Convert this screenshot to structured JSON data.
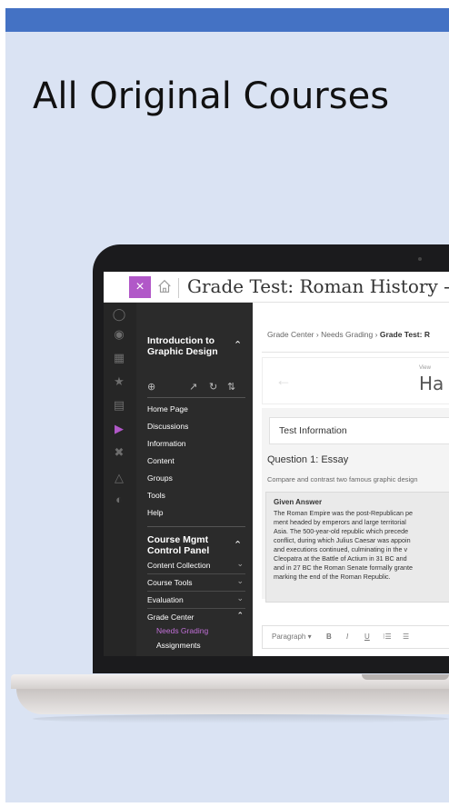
{
  "slide": {
    "title": "All Original Courses"
  },
  "appbar": {
    "title": "Grade Test: Roman History - Exam",
    "close_label": "×"
  },
  "rail": {
    "icons": [
      "user-icon",
      "globe-icon",
      "building-icon",
      "groups-icon",
      "calendar-icon",
      "grades-icon",
      "tools-icon",
      "people-icon",
      "signout-icon"
    ]
  },
  "course_menu": {
    "title": "Introduction to Graphic Design",
    "items": [
      "Home Page",
      "Discussions",
      "Information",
      "Content",
      "Groups",
      "Tools",
      "Help"
    ],
    "panel_title": "Course Mgmt Control Panel",
    "panel_rows": [
      "Content Collection",
      "Course Tools",
      "Evaluation",
      "Grade Center"
    ],
    "grade_center_sub": [
      "Needs Grading",
      "Assignments"
    ]
  },
  "main": {
    "breadcrumb_1": "Grade Center",
    "breadcrumb_sep": "›",
    "breadcrumb_2": "Needs Grading",
    "breadcrumb_3": "Grade Test: R",
    "view_label": "View",
    "student_name": "Ha",
    "test_info": "Test Information",
    "question_title": "Question 1: Essay",
    "question_text": "Compare and contrast two famous graphic design",
    "answer_label": "Given Answer",
    "answer_lines": [
      "The Roman Empire was the post-Republican pe",
      "ment headed by emperors and large territorial",
      "Asia. The 500-year-old republic which precede",
      "conflict, during which Julius Caesar was appoin",
      "and executions continued, culminating in the v",
      "Cleopatra at the Battle of Actium in 31 BC and",
      "and in 27 BC the Roman Senate formally grante",
      "marking the end of the Roman Republic."
    ],
    "editor": {
      "format": "Paragraph ▾",
      "bold": "B",
      "italic": "I",
      "underline": "U",
      "list1": "⁝☰",
      "list2": "☰"
    }
  }
}
